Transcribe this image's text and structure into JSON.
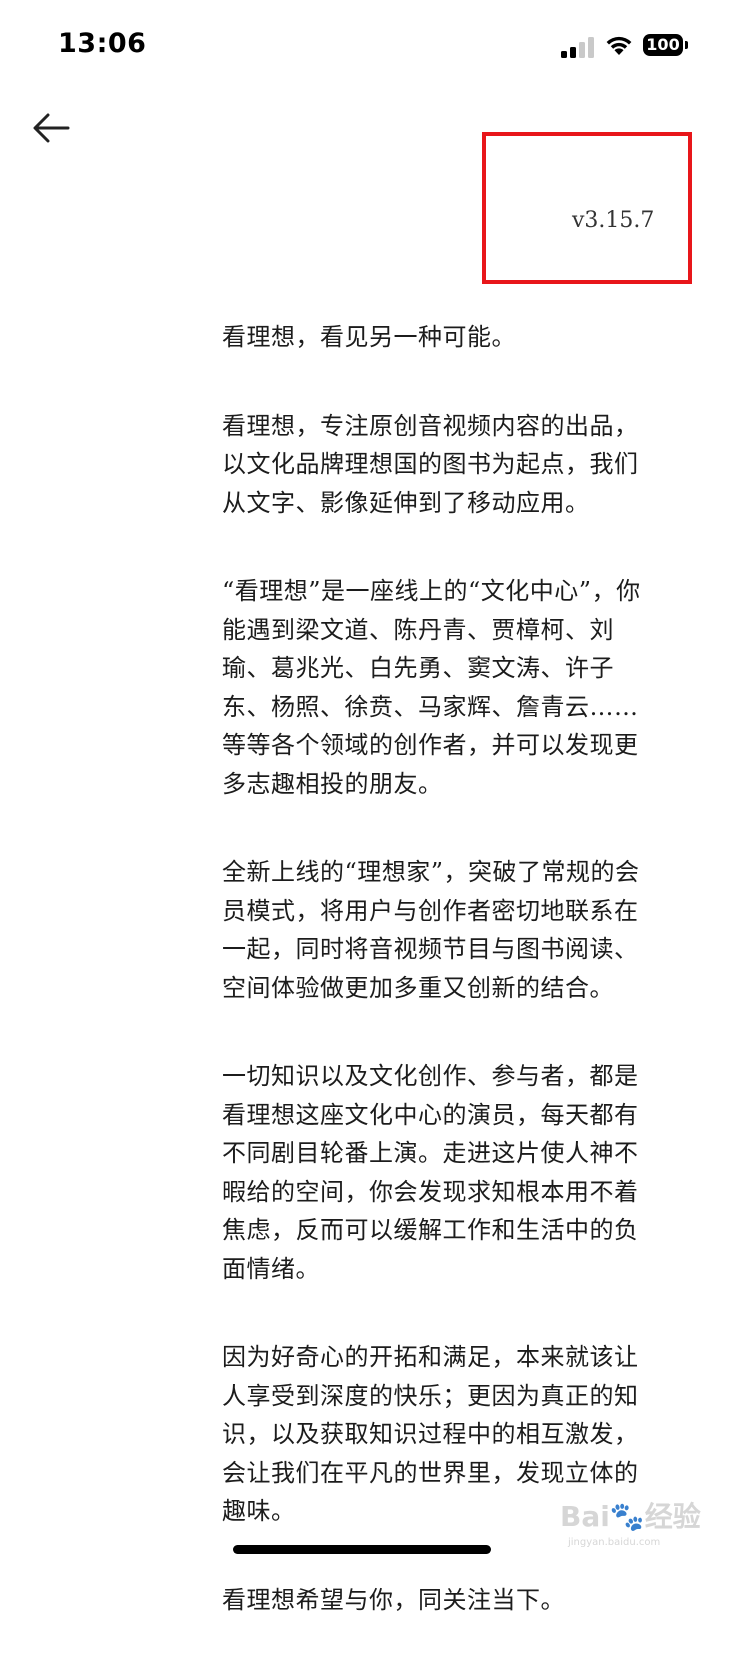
{
  "status_bar": {
    "time": "13:06",
    "battery": "100",
    "signal_bars_filled": 2,
    "signal_bars_total": 4
  },
  "nav": {
    "back_icon": "arrow-left-icon"
  },
  "version": "v3.15.7",
  "highlight_color": "#e8161a",
  "paragraphs": [
    "看理想，看见另一种可能。",
    "看理想，专注原创音视频内容的出品，以文化品牌理想国的图书为起点，我们从文字、影像延伸到了移动应用。",
    "“看理想”是一座线上的“文化中心”，你能遇到梁文道、陈丹青、贾樟柯、刘瑜、葛兆光、白先勇、窦文涛、许子东、杨照、徐贲、马家辉、詹青云……等等各个领域的创作者，并可以发现更多志趣相投的朋友。",
    "全新上线的“理想家”，突破了常规的会员模式，将用户与创作者密切地联系在一起，同时将音视频节目与图书阅读、空间体验做更加多重又创新的结合。",
    "一切知识以及文化创作、参与者，都是看理想这座文化中心的演员，每天都有不同剧目轮番上演。走进这片使人神不暇给的空间，你会发现求知根本用不着焦虑，反而可以缓解工作和生活中的负面情绪。",
    "因为好奇心的开拓和满足，本来就该让人享受到深度的快乐；更因为真正的知识，以及获取知识过程中的相互激发，会让我们在平凡的世界里，发现立体的趣味。",
    "看理想希望与你，同关注当下。"
  ],
  "watermark": {
    "brand": "Bai",
    "suffix": "经验",
    "url": "jingyan.baidu.com"
  }
}
